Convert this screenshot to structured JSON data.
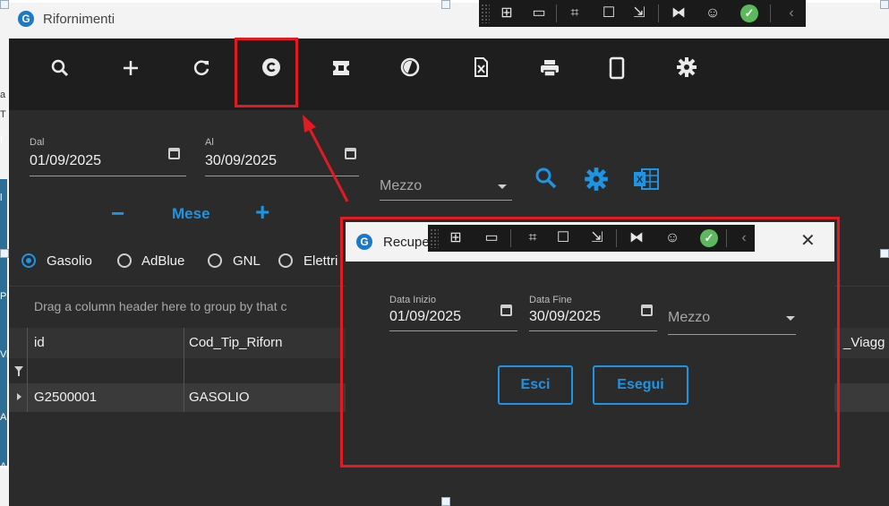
{
  "window": {
    "title": "Rifornimenti"
  },
  "toolbar": {
    "icons": [
      "search-icon",
      "plus-icon",
      "refresh-icon",
      "recover-icon",
      "ticket-icon",
      "history-icon",
      "delete-doc-icon",
      "print-icon",
      "mobile-icon",
      "gear-icon"
    ]
  },
  "filters": {
    "from_label": "Dal",
    "from_value": "01/09/2025",
    "to_label": "Al",
    "to_value": "30/09/2025",
    "vehicle_placeholder": "Mezzo",
    "month_label": "Mese",
    "minus": "−",
    "plus": "+"
  },
  "fuel_types": [
    {
      "label": "Gasolio",
      "selected": true
    },
    {
      "label": "AdBlue",
      "selected": false
    },
    {
      "label": "GNL",
      "selected": false
    },
    {
      "label": "Elettri",
      "selected": false
    }
  ],
  "grid": {
    "group_hint": "Drag a column header here to group by that c",
    "columns": [
      "id",
      "Cod_Tip_Riforn",
      "_Viagg"
    ],
    "rows": [
      {
        "id": "G2500001",
        "cod": "GASOLIO"
      }
    ]
  },
  "dialog": {
    "title": "Recupe",
    "start_label": "Data Inizio",
    "start_value": "01/09/2025",
    "end_label": "Data Fine",
    "end_value": "30/09/2025",
    "vehicle_placeholder": "Mezzo",
    "cancel_label": "Esci",
    "run_label": "Esegui",
    "close_label": "✕"
  },
  "background_window": {
    "left_chars": [
      "a",
      "T",
      "I",
      "l",
      "Pl",
      "Vi",
      "Al",
      "Al"
    ]
  },
  "colors": {
    "accent": "#1d94e4",
    "highlight": "#e21b22",
    "dark_bg": "#2b2b2b",
    "toolbar_bg": "#1e1e1e"
  }
}
